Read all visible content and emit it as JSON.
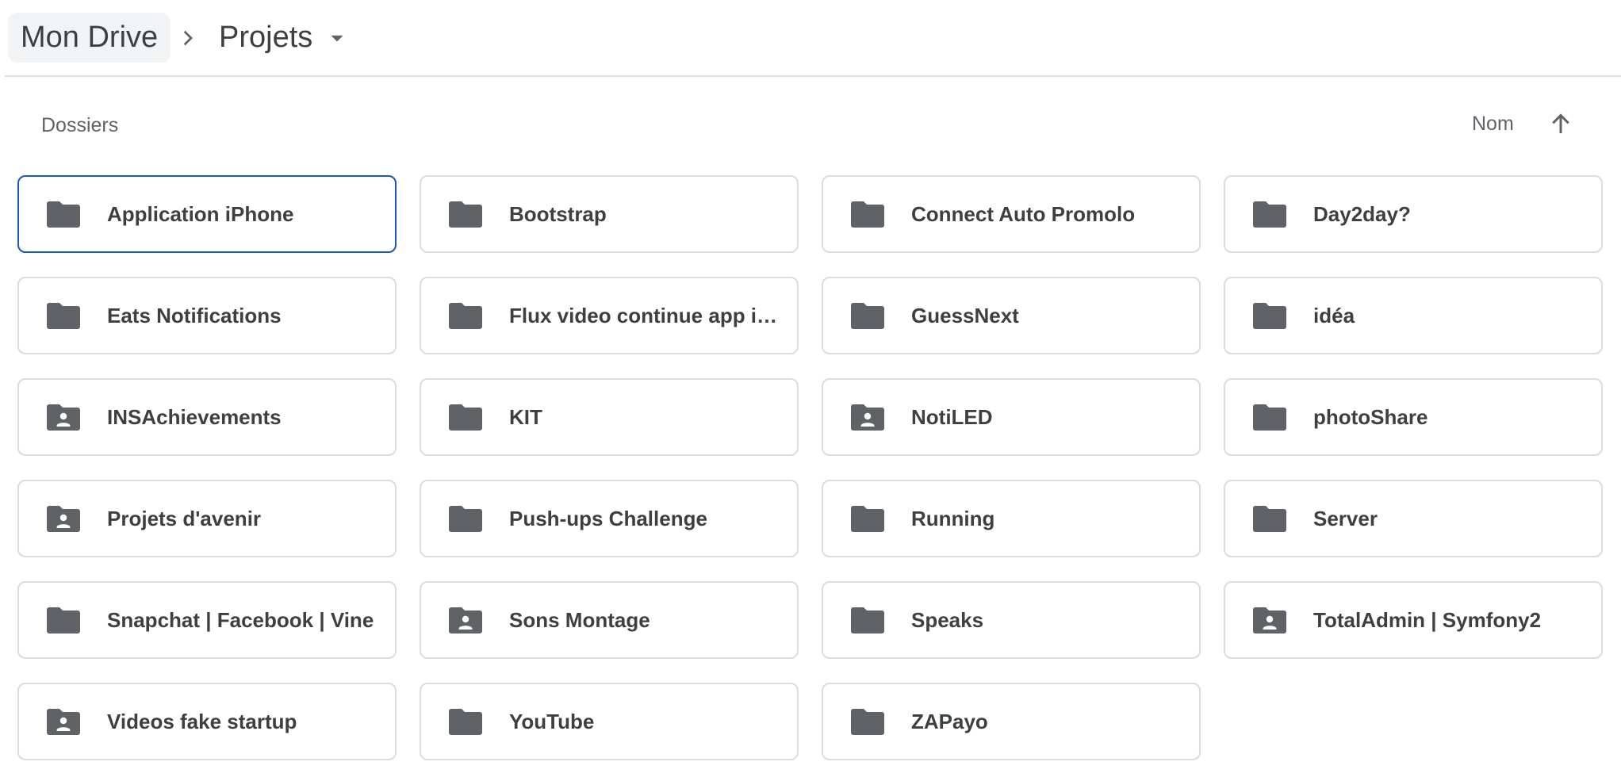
{
  "breadcrumb": {
    "root": "Mon Drive",
    "current": "Projets"
  },
  "section_title": "Dossiers",
  "sort": {
    "label": "Nom",
    "direction_icon": "arrow-up-icon"
  },
  "folders": [
    {
      "name": "Application iPhone",
      "shared": false,
      "selected": true
    },
    {
      "name": "Bootstrap",
      "shared": false
    },
    {
      "name": "Connect Auto Promolo",
      "shared": false
    },
    {
      "name": "Day2day?",
      "shared": false
    },
    {
      "name": "Eats Notifications",
      "shared": false
    },
    {
      "name": "Flux video continue app iPh…",
      "shared": false
    },
    {
      "name": "GuessNext",
      "shared": false
    },
    {
      "name": "idéa",
      "shared": false
    },
    {
      "name": "INSAchievements",
      "shared": true
    },
    {
      "name": "KIT",
      "shared": false
    },
    {
      "name": "NotiLED",
      "shared": true
    },
    {
      "name": "photoShare",
      "shared": false
    },
    {
      "name": "Projets d'avenir",
      "shared": true
    },
    {
      "name": "Push-ups Challenge",
      "shared": false
    },
    {
      "name": "Running",
      "shared": false
    },
    {
      "name": "Server",
      "shared": false
    },
    {
      "name": "Snapchat | Facebook | Vine",
      "shared": false
    },
    {
      "name": "Sons Montage",
      "shared": true
    },
    {
      "name": "Speaks",
      "shared": false
    },
    {
      "name": "TotalAdmin | Symfony2",
      "shared": true
    },
    {
      "name": "Videos fake startup",
      "shared": true
    },
    {
      "name": "YouTube",
      "shared": false
    },
    {
      "name": "ZAPayo",
      "shared": false
    }
  ],
  "colors": {
    "icon": "#5f6368",
    "selected_border": "#1a56c4",
    "card_border": "#dadce0"
  }
}
